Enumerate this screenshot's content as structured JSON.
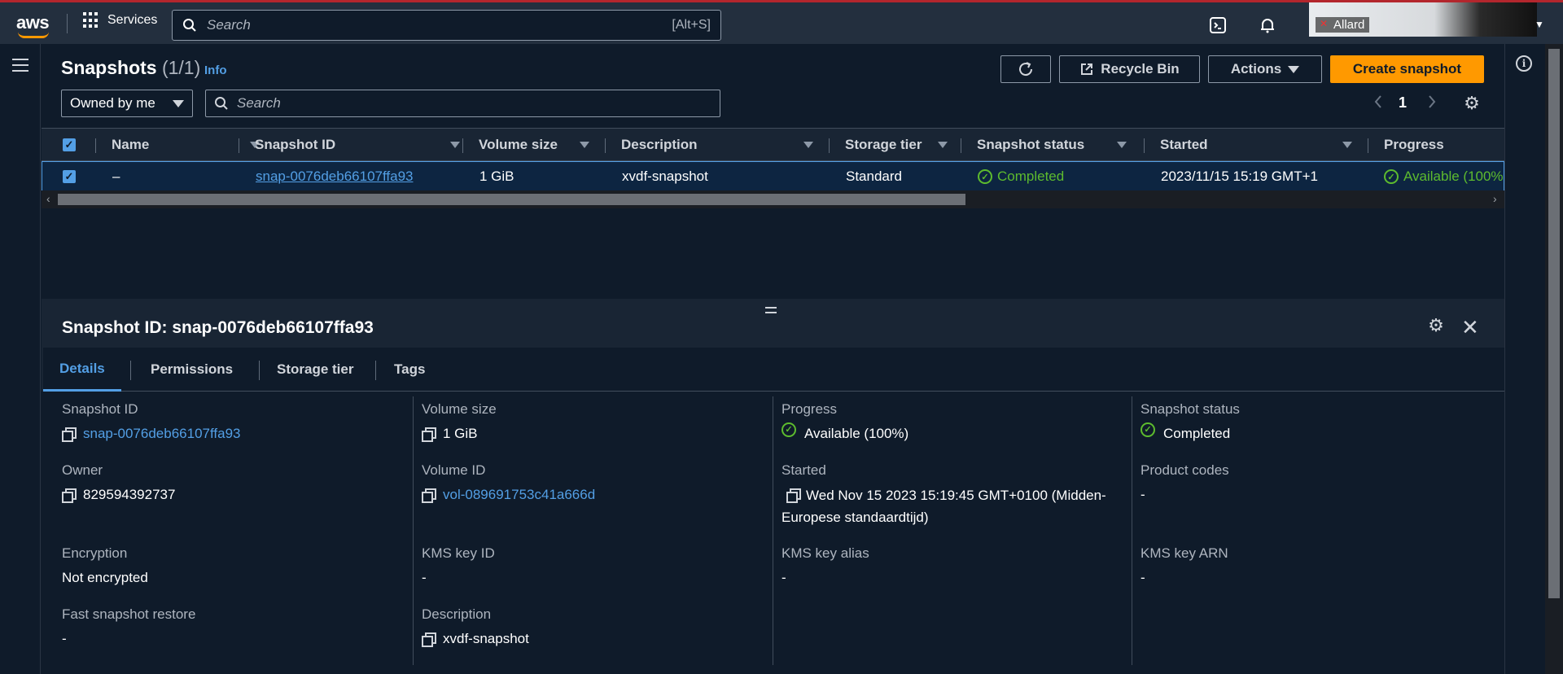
{
  "topbar": {
    "logo": "aws",
    "services_label": "Services",
    "search_placeholder": "Search",
    "search_shortcut": "[Alt+S]",
    "video_user": "Allard"
  },
  "page": {
    "title": "Snapshots",
    "count": "(1/1)",
    "info_link": "Info",
    "buttons": {
      "recycle_bin": "Recycle Bin",
      "actions": "Actions",
      "create": "Create snapshot"
    },
    "owner_filter": "Owned by me",
    "filter_placeholder": "Search",
    "page_number": "1"
  },
  "table": {
    "columns": [
      "Name",
      "Snapshot ID",
      "Volume size",
      "Description",
      "Storage tier",
      "Snapshot status",
      "Started",
      "Progress"
    ],
    "rows": [
      {
        "name": "–",
        "snapshot_id": "snap-0076deb66107ffa93",
        "volume_size": "1 GiB",
        "description": "xvdf-snapshot",
        "storage_tier": "Standard",
        "status": "Completed",
        "started": "2023/11/15 15:19 GMT+1",
        "progress": "Available (100%"
      }
    ]
  },
  "detail": {
    "title": "Snapshot ID: snap-0076deb66107ffa93",
    "tabs": [
      "Details",
      "Permissions",
      "Storage tier",
      "Tags"
    ],
    "fields": {
      "snapshot_id": {
        "label": "Snapshot ID",
        "value": "snap-0076deb66107ffa93"
      },
      "owner": {
        "label": "Owner",
        "value": "829594392737"
      },
      "encryption": {
        "label": "Encryption",
        "value": "Not encrypted"
      },
      "fast_restore": {
        "label": "Fast snapshot restore",
        "value": "-"
      },
      "volume_size": {
        "label": "Volume size",
        "value": "1 GiB"
      },
      "volume_id": {
        "label": "Volume ID",
        "value": "vol-089691753c41a666d"
      },
      "kms_key_id": {
        "label": "KMS key ID",
        "value": "-"
      },
      "description": {
        "label": "Description",
        "value": "xvdf-snapshot"
      },
      "progress": {
        "label": "Progress",
        "value": "Available (100%)"
      },
      "started": {
        "label": "Started",
        "value": "Wed Nov 15 2023 15:19:45 GMT+0100 (Midden-Europese standaardtijd)"
      },
      "kms_key_alias": {
        "label": "KMS key alias",
        "value": "-"
      },
      "status": {
        "label": "Snapshot status",
        "value": "Completed"
      },
      "product_codes": {
        "label": "Product codes",
        "value": "-"
      },
      "kms_key_arn": {
        "label": "KMS key ARN",
        "value": "-"
      }
    }
  },
  "colors": {
    "accent": "#539fe5",
    "primary_button": "#ff9900",
    "success": "#5dbb2e",
    "background": "#0f1b2a"
  }
}
